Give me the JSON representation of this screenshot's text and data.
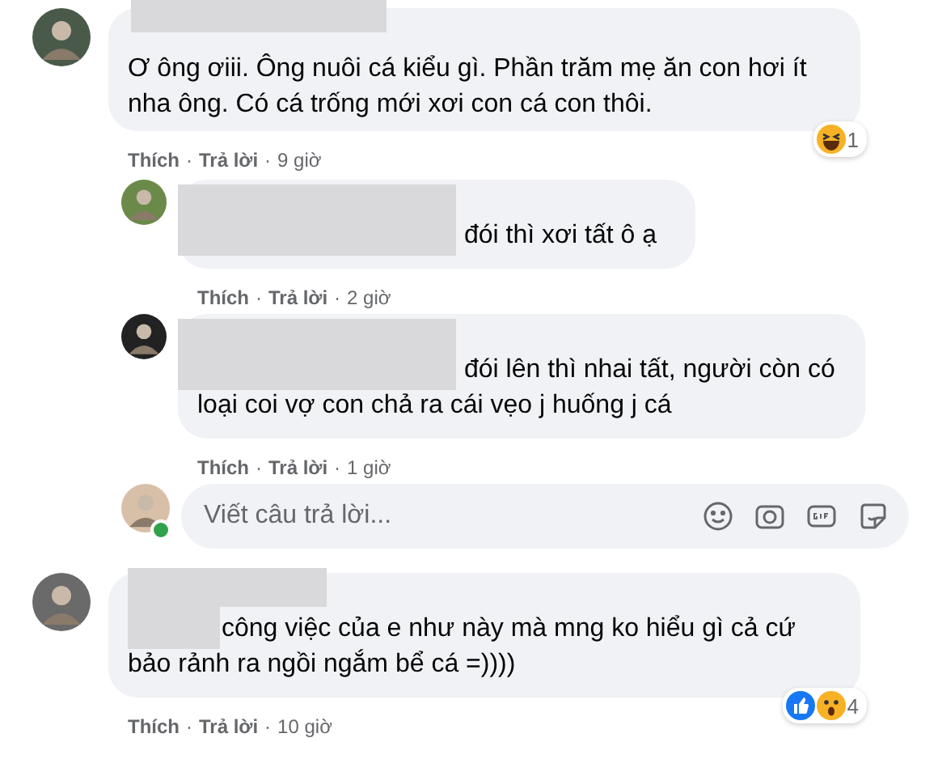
{
  "comments": [
    {
      "kind": "name_hidden",
      "text": "Ơ ông ơiii. Ông nuôi cá kiểu gì. Phần trăm mẹ ăn con hơi ít nha ông. Có cá trống mới xơi con cá con thôi.",
      "actions": [
        {
          "kind": "link",
          "label": "Thích"
        },
        {
          "kind": "dot",
          "label": "·"
        },
        {
          "kind": "link",
          "label": "Trả lời"
        },
        {
          "kind": "dot",
          "label": "·"
        },
        {
          "kind": "time",
          "label": "9 giờ"
        }
      ],
      "reactions": {
        "icons": [
          {
            "kind": "haha"
          }
        ],
        "count": "1"
      },
      "replies": [
        {
          "kind": "start_hidden",
          "text": "đói thì xơi tất ô ạ",
          "actions": [
            {
              "kind": "link",
              "label": "Thích"
            },
            {
              "kind": "dot",
              "label": "·"
            },
            {
              "kind": "link",
              "label": "Trả lời"
            },
            {
              "kind": "dot",
              "label": "·"
            },
            {
              "kind": "time",
              "label": "2 giờ"
            }
          ]
        },
        {
          "kind": "start_hidden",
          "text": "đói lên thì nhai tất, người còn có loại coi vợ con chả ra cái vẹo j huống j cá",
          "actions": [
            {
              "kind": "link",
              "label": "Thích"
            },
            {
              "kind": "dot",
              "label": "·"
            },
            {
              "kind": "link",
              "label": "Trả lời"
            },
            {
              "kind": "dot",
              "label": "·"
            },
            {
              "kind": "time",
              "label": "1 giờ"
            }
          ]
        }
      ],
      "reply_box": {
        "placeholder": "Viết câu trả lời...",
        "online": true
      }
    },
    {
      "kind": "corner_hidden",
      "text": "công việc của e như này mà mng ko hiểu gì cả cứ bảo rảnh ra ngồi ngắm bể cá =))))",
      "actions": [
        {
          "kind": "link",
          "label": "Thích"
        },
        {
          "kind": "dot",
          "label": "·"
        },
        {
          "kind": "link",
          "label": "Trả lời"
        },
        {
          "kind": "dot",
          "label": "·"
        },
        {
          "kind": "time",
          "label": "10 giờ"
        }
      ],
      "reactions": {
        "icons": [
          {
            "kind": "like"
          },
          {
            "kind": "wow"
          }
        ],
        "count": "4"
      }
    }
  ]
}
